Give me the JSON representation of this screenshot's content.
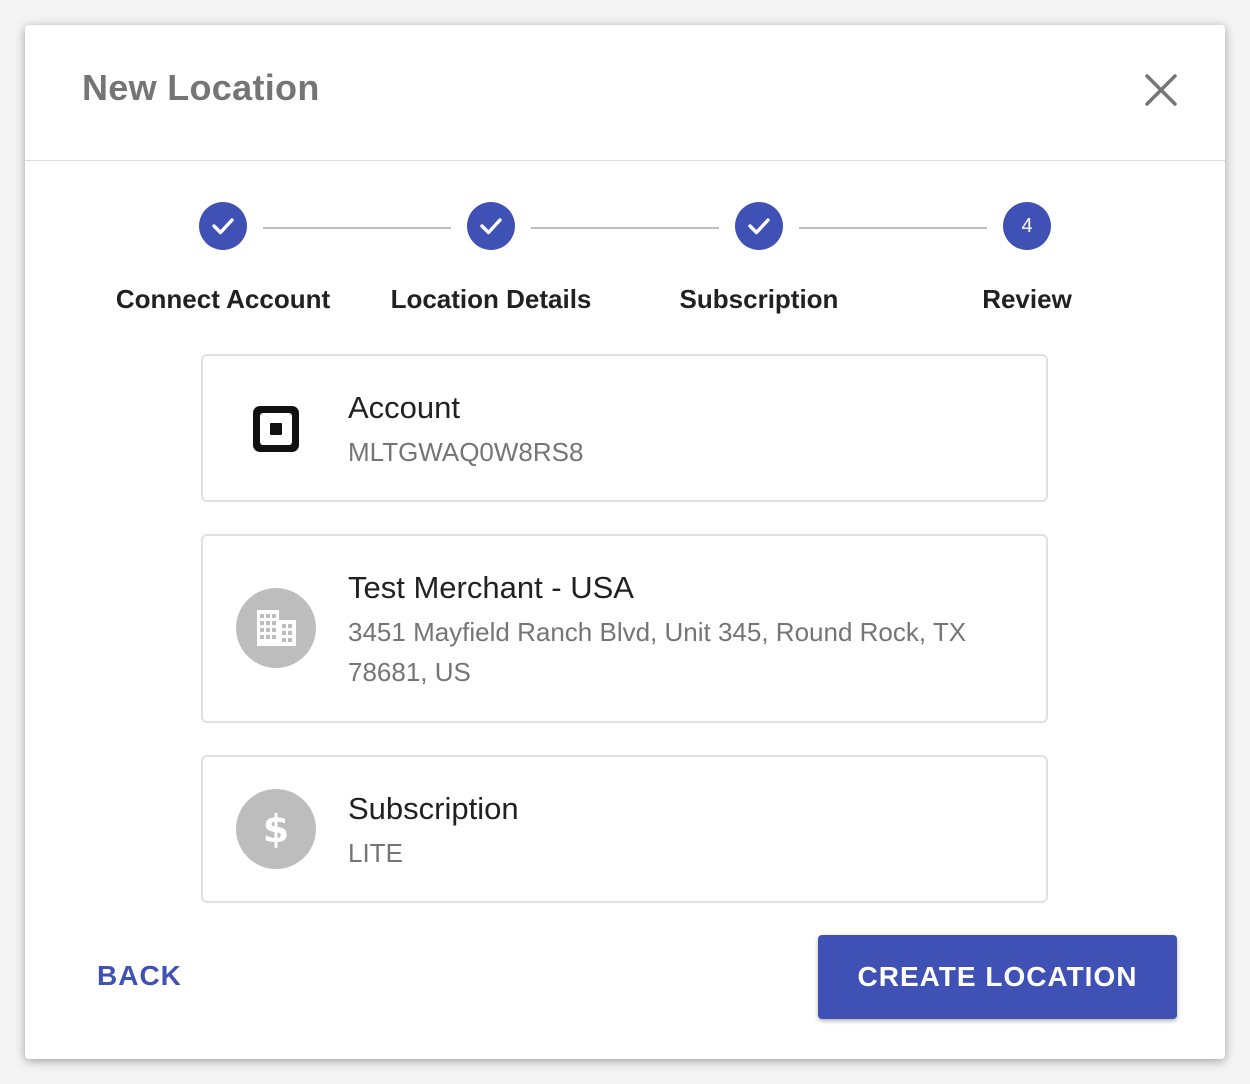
{
  "dialog": {
    "title": "New Location"
  },
  "stepper": {
    "steps": [
      {
        "label": "Connect Account",
        "state": "complete"
      },
      {
        "label": "Location Details",
        "state": "complete"
      },
      {
        "label": "Subscription",
        "state": "complete"
      },
      {
        "label": "Review",
        "state": "active",
        "number": "4"
      }
    ]
  },
  "review": {
    "account": {
      "title": "Account",
      "value": "MLTGWAQ0W8RS8",
      "icon": "square-logo-icon"
    },
    "location": {
      "title": "Test Merchant - USA",
      "address": "3451 Mayfield Ranch Blvd, Unit 345, Round Rock, TX 78681, US",
      "icon": "building-icon"
    },
    "subscription": {
      "title": "Subscription",
      "value": "LITE",
      "icon": "dollar-icon"
    }
  },
  "actions": {
    "back_label": "BACK",
    "create_label": "CREATE LOCATION"
  },
  "colors": {
    "primary": "#3f51b5",
    "avatar_bg": "#bdbdbd",
    "title_text": "#757575"
  }
}
